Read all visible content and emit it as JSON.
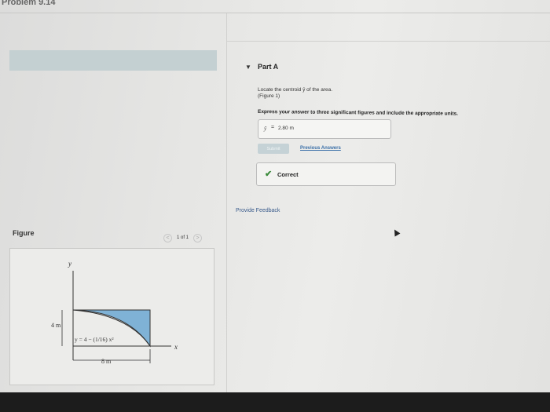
{
  "header": {
    "problem_title": "Problem 9.14"
  },
  "part": {
    "title": "Part A",
    "prompt": "Locate the centroid ȳ of the area.",
    "figure_ref": "(Figure 1)",
    "instruction": "Express your answer to three significant figures and include the appropriate units.",
    "answer": {
      "symbol": "ȳ",
      "equals": "=",
      "value": "2.80 m"
    },
    "submit_label": "Submit",
    "previous_answers_label": "Previous Answers",
    "result": {
      "icon": "check-icon",
      "text": "Correct",
      "color": "#3a8a3a"
    }
  },
  "feedback_link": "Provide Feedback",
  "figure": {
    "label": "Figure",
    "pager": {
      "prev": "<",
      "count": "1 of 1",
      "next": ">"
    },
    "diagram": {
      "y_axis": "y",
      "x_axis": "x",
      "height_dim": "4 m",
      "width_dim": "8 m",
      "equation": "y = 4 − (1/16) x²",
      "fill_color": "#7fb2d6"
    }
  },
  "colors": {
    "link": "#3a6fa8",
    "banner": "#c4d0d2"
  }
}
